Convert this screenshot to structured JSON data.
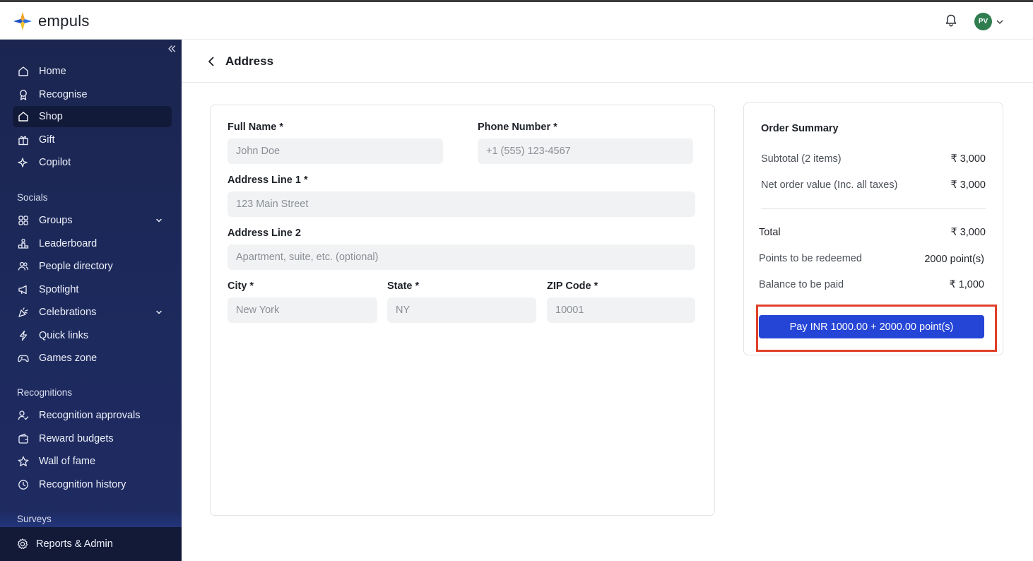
{
  "app": {
    "name": "empuls",
    "avatar_initials": "PV"
  },
  "sidebar": {
    "items": [
      {
        "label": "Home",
        "icon": "home-icon"
      },
      {
        "label": "Recognise",
        "icon": "award-icon"
      },
      {
        "label": "Shop",
        "icon": "shop-icon",
        "active": true
      },
      {
        "label": "Gift",
        "icon": "gift-icon"
      },
      {
        "label": "Copilot",
        "icon": "sparkle-icon"
      }
    ],
    "socials_title": "Socials",
    "socials": [
      {
        "label": "Groups",
        "icon": "groups-icon",
        "expandable": true
      },
      {
        "label": "Leaderboard",
        "icon": "leaderboard-icon"
      },
      {
        "label": "People directory",
        "icon": "people-icon"
      },
      {
        "label": "Spotlight",
        "icon": "megaphone-icon"
      },
      {
        "label": "Celebrations",
        "icon": "party-icon",
        "expandable": true
      },
      {
        "label": "Quick links",
        "icon": "lightning-icon"
      },
      {
        "label": "Games zone",
        "icon": "gamepad-icon"
      }
    ],
    "recognitions_title": "Recognitions",
    "recognitions": [
      {
        "label": "Recognition approvals",
        "icon": "approval-icon"
      },
      {
        "label": "Reward budgets",
        "icon": "wallet-icon"
      },
      {
        "label": "Wall of fame",
        "icon": "star-icon"
      },
      {
        "label": "Recognition history",
        "icon": "history-icon"
      }
    ],
    "surveys_title": "Surveys",
    "footer_label": "Reports & Admin"
  },
  "page": {
    "title": "Address"
  },
  "form": {
    "full_name": {
      "label": "Full Name *",
      "placeholder": "John Doe"
    },
    "phone": {
      "label": "Phone Number *",
      "placeholder": "+1 (555) 123-4567"
    },
    "address1": {
      "label": "Address Line 1 *",
      "placeholder": "123 Main Street"
    },
    "address2": {
      "label": "Address Line 2",
      "placeholder": "Apartment, suite, etc. (optional)"
    },
    "city": {
      "label": "City *",
      "placeholder": "New York"
    },
    "state": {
      "label": "State *",
      "placeholder": "NY"
    },
    "zip": {
      "label": "ZIP Code *",
      "placeholder": "10001"
    }
  },
  "summary": {
    "title": "Order Summary",
    "subtotal_label": "Subtotal (2 items)",
    "subtotal_value": "₹ 3,000",
    "net_label": "Net order value (Inc. all taxes)",
    "net_value": "₹ 3,000",
    "total_label": "Total",
    "total_value": "₹ 3,000",
    "points_label": "Points to be redeemed",
    "points_value": "2000 point(s)",
    "balance_label": "Balance to be paid",
    "balance_value": "₹ 1,000",
    "pay_button": "Pay INR 1000.00 + 2000.00 point(s)"
  },
  "colors": {
    "sidebar": "#1b2550",
    "accent": "#2545d6",
    "highlight": "#e0402a",
    "avatar": "#2f7d4f"
  }
}
